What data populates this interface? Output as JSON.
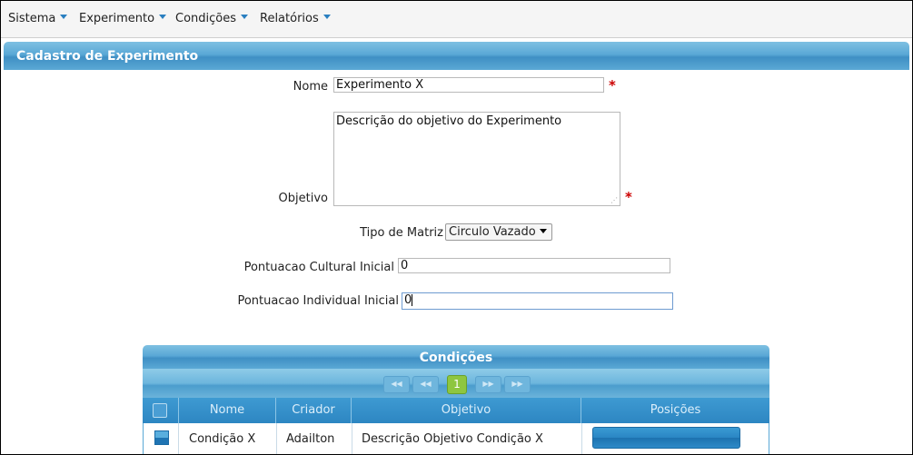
{
  "menu": {
    "sistema": "Sistema",
    "experimento": "Experimento",
    "condicoes": "Condições",
    "relatorios": "Relatórios"
  },
  "form": {
    "title": "Cadastro de Experimento",
    "nome_label": "Nome",
    "nome_value": "Experimento X",
    "objetivo_label": "Objetivo",
    "objetivo_value": "Descrição do objetivo do Experimento",
    "tipo_matriz_label": "Tipo de Matriz",
    "tipo_matriz_value": "Circulo Vazado",
    "cultural_label": "Pontuacao Cultural Inicial",
    "cultural_value": "0",
    "individual_label": "Pontuacao Individual Inicial",
    "individual_value": "0",
    "required_mark": "*"
  },
  "condicoes": {
    "title": "Condições",
    "pager": {
      "first": "◀◀",
      "prev": "◀◀",
      "current_page": "1",
      "next": "▶▶",
      "last": "▶▶"
    },
    "columns": [
      "Nome",
      "Criador",
      "Objetivo",
      "Posições"
    ],
    "rows": [
      {
        "nome": "Condição X",
        "criador": "Adailton",
        "objetivo": "Descrição Objetivo Condição X"
      }
    ]
  },
  "colors": {
    "accent": "#3f8fc4",
    "required": "#cc0000",
    "page_active": "#8ec640"
  }
}
